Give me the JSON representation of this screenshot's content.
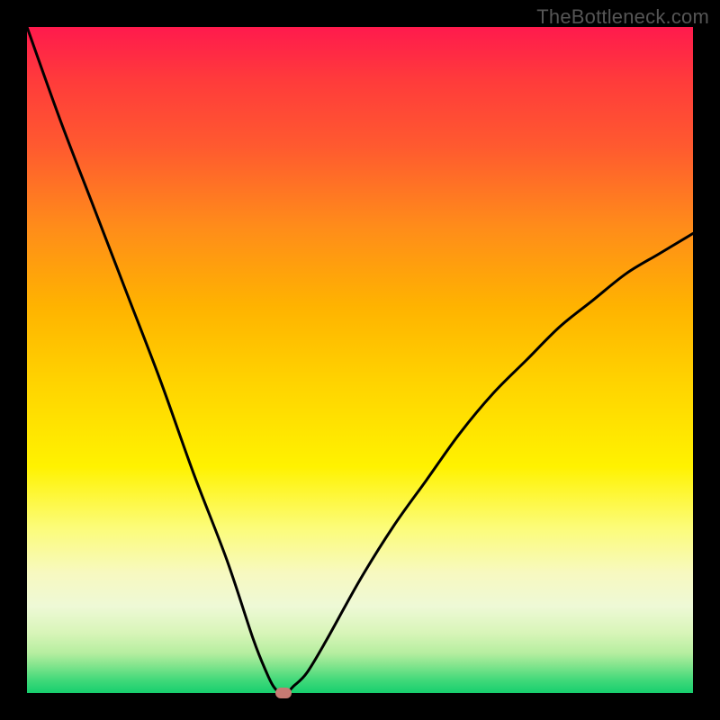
{
  "watermark": "TheBottleneck.com",
  "colors": {
    "frame_bg": "#000000",
    "curve_stroke": "#000000",
    "marker_fill": "#c77a73",
    "gradient_top": "#ff1a4d",
    "gradient_bottom": "#16cf6e"
  },
  "chart_data": {
    "type": "line",
    "title": "",
    "xlabel": "",
    "ylabel": "",
    "xlim": [
      0,
      100
    ],
    "ylim": [
      0,
      100
    ],
    "grid": false,
    "legend": false,
    "series": [
      {
        "name": "bottleneck-curve",
        "x": [
          0,
          5,
          10,
          15,
          20,
          25,
          30,
          34,
          36,
          37,
          38,
          39,
          40,
          42,
          45,
          50,
          55,
          60,
          65,
          70,
          75,
          80,
          85,
          90,
          95,
          100
        ],
        "y": [
          100,
          86,
          73,
          60,
          47,
          33,
          20,
          8,
          3,
          1,
          0,
          0,
          1,
          3,
          8,
          17,
          25,
          32,
          39,
          45,
          50,
          55,
          59,
          63,
          66,
          69
        ]
      }
    ],
    "annotations": [
      {
        "name": "optimal-marker",
        "x": 38.5,
        "y": 0
      }
    ]
  }
}
